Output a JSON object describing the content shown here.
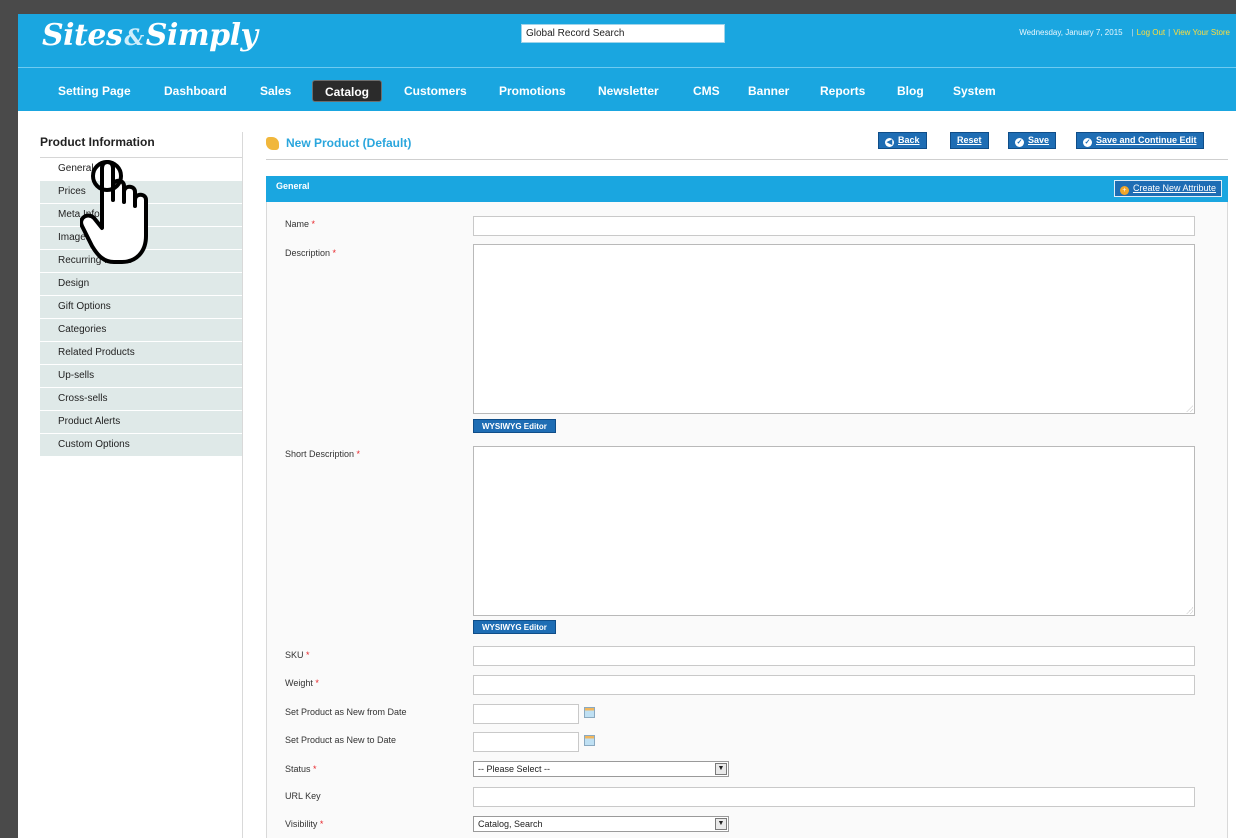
{
  "header": {
    "logo_left": "Sites",
    "logo_mid": "&",
    "logo_right": "Simply",
    "search_value": "Global Record Search",
    "date": "Wednesday, January 7, 2015",
    "logout": "Log Out",
    "view_store": "View Your Store"
  },
  "nav": [
    {
      "label": "Setting Page"
    },
    {
      "label": "Dashboard"
    },
    {
      "label": "Sales"
    },
    {
      "label": "Catalog",
      "active": true
    },
    {
      "label": "Customers"
    },
    {
      "label": "Promotions"
    },
    {
      "label": "Newsletter"
    },
    {
      "label": "CMS"
    },
    {
      "label": "Banner"
    },
    {
      "label": "Reports"
    },
    {
      "label": "Blog"
    },
    {
      "label": "System"
    }
  ],
  "sidebar": {
    "title": "Product Information",
    "items": [
      {
        "label": "General"
      },
      {
        "label": "Prices"
      },
      {
        "label": "Meta Information"
      },
      {
        "label": "Images"
      },
      {
        "label": "Recurring Profile"
      },
      {
        "label": "Design"
      },
      {
        "label": "Gift Options"
      },
      {
        "label": "Categories"
      },
      {
        "label": "Related Products"
      },
      {
        "label": "Up-sells"
      },
      {
        "label": "Cross-sells"
      },
      {
        "label": "Product Alerts"
      },
      {
        "label": "Custom Options"
      }
    ]
  },
  "page": {
    "title": "New Product (Default)",
    "back": "Back",
    "reset": "Reset",
    "save": "Save",
    "save_continue": "Save and Continue Edit"
  },
  "section": {
    "title": "General",
    "create_attribute": "Create New Attribute"
  },
  "form": {
    "required_mark": "*",
    "name_label": "Name",
    "description_label": "Description",
    "wysiwyg": "WYSIWYG Editor",
    "short_description_label": "Short Description",
    "sku_label": "SKU",
    "weight_label": "Weight",
    "new_from_label": "Set Product as New from Date",
    "new_to_label": "Set Product as New to Date",
    "status_label": "Status",
    "status_value": "-- Please Select --",
    "url_key_label": "URL Key",
    "visibility_label": "Visibility",
    "visibility_value": "Catalog, Search"
  },
  "icons": {
    "page_title": "product-box-icon",
    "cursor": "hand-pointer-icon",
    "calendar": "calendar-icon",
    "select_arrow": "chevron-down-icon"
  },
  "colors": {
    "header_bg": "#1aa6e0",
    "button_bg": "#1e6db4",
    "required": "#e8252a",
    "accent_link": "#ffde3d"
  }
}
